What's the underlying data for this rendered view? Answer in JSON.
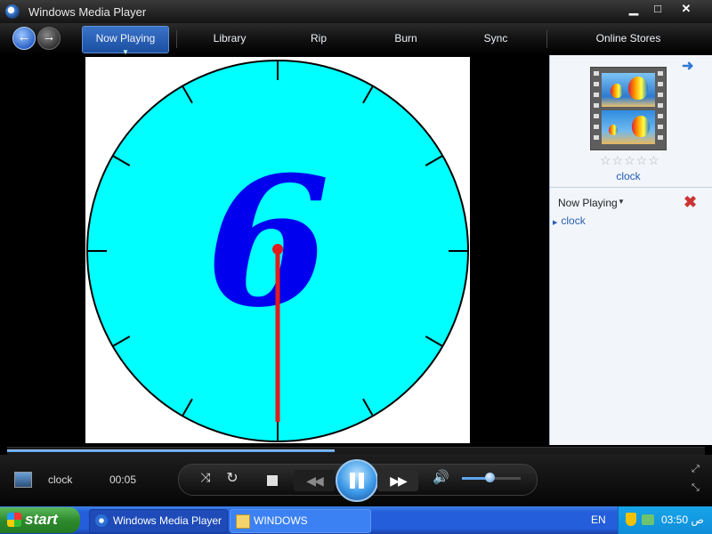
{
  "window": {
    "title": "Windows Media Player",
    "min": "▁",
    "max": "□",
    "close": "✕"
  },
  "nav": {
    "back": "←",
    "forward": "→",
    "tabs": [
      {
        "label": "Now Playing",
        "active": true
      },
      {
        "label": "Library"
      },
      {
        "label": "Rip"
      },
      {
        "label": "Burn"
      },
      {
        "label": "Sync"
      },
      {
        "label": "Online Stores"
      }
    ]
  },
  "video": {
    "clock_face_color": "#00ffff",
    "hand_color": "#e21b1b",
    "number": "6",
    "number_color": "#0000ee",
    "tick_count": 12
  },
  "panel": {
    "arrow": "➜",
    "stars": "☆☆☆☆☆",
    "album_caption": "clock",
    "now_playing_label": "Now Playing",
    "dropdown": "▼",
    "clear_icon": "✖",
    "playlist": [
      "clock"
    ]
  },
  "player": {
    "title": "clock",
    "time": "00:05",
    "seek_progress": 0.47,
    "volume_level": 0.5,
    "shuffle": "⤨",
    "repeat": "↻",
    "prev": "◀◀",
    "next": "▶▶",
    "mute": "🔊",
    "fullscreen": "⤢",
    "compact": "⤡"
  },
  "taskbar": {
    "start_label": "start",
    "tasks": [
      {
        "label": "Windows Media Player",
        "active": true
      },
      {
        "label": "WINDOWS",
        "active": false
      }
    ],
    "language": "EN",
    "clock": "03:50 ص"
  }
}
